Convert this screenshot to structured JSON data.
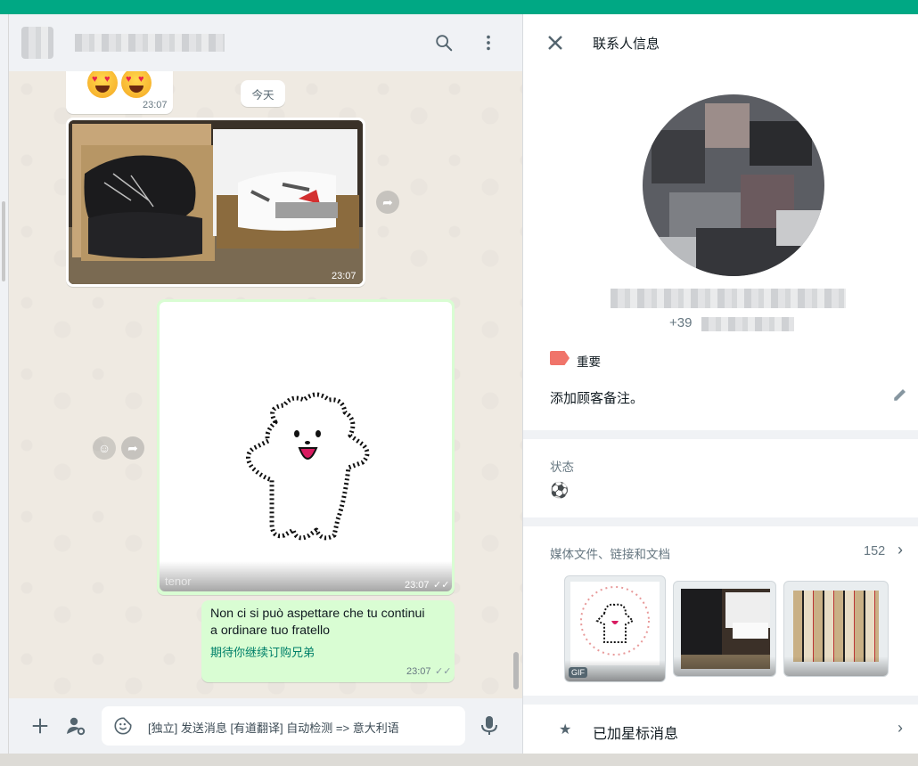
{
  "chat": {
    "date_divider": "今天",
    "messages": [
      {
        "type": "emoji",
        "content": "😍😍",
        "time": "23:07"
      },
      {
        "type": "photo",
        "description": "shoes",
        "time": "23:07"
      },
      {
        "type": "gif",
        "watermark": "tenor",
        "time": "23:07"
      },
      {
        "type": "text",
        "text_line1": "Non ci si può aspettare che tu continui",
        "text_line2": "a ordinare tuo fratello",
        "translation": "期待你继续订购兄弟",
        "time": "23:07"
      }
    ],
    "input_placeholder": "[独立] 发送消息 [有道翻译] 自动检测 => 意大利语"
  },
  "contact_info": {
    "title": "联系人信息",
    "phone_prefix": "+39",
    "label_tag": "重要",
    "label_color": "#f0746a",
    "note_placeholder": "添加顾客备注。",
    "status_title": "状态",
    "status_value": "⚽",
    "media_title": "媒体文件、链接和文档",
    "media_count": "152",
    "gif_badge": "GIF",
    "starred_title": "已加星标消息"
  },
  "colors": {
    "accent": "#00a884",
    "outgoing_bubble": "#d9fdd3",
    "translation": "#008069"
  }
}
